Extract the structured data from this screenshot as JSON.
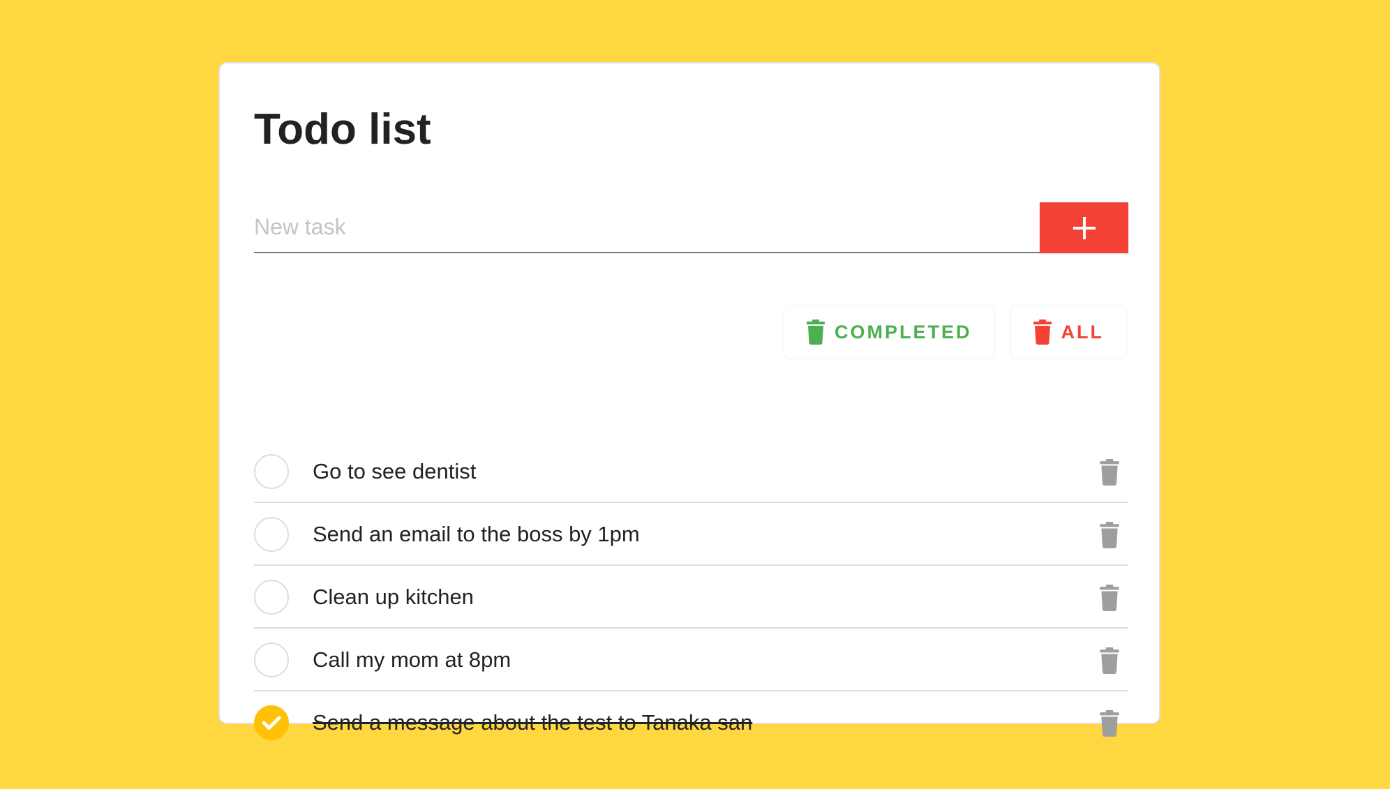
{
  "title": "Todo list",
  "new_task": {
    "placeholder": "New task",
    "value": "",
    "add_icon": "plus-icon"
  },
  "actions": {
    "delete_completed_label": "COMPLETED",
    "delete_all_label": "ALL",
    "icon": "trash-icon"
  },
  "tasks": [
    {
      "text": "Go to see dentist",
      "completed": false
    },
    {
      "text": "Send an email to the boss by 1pm",
      "completed": false
    },
    {
      "text": "Clean up kitchen",
      "completed": false
    },
    {
      "text": "Call my mom at 8pm",
      "completed": false
    },
    {
      "text": "Send a message about the test to Tanaka san",
      "completed": true
    }
  ],
  "colors": {
    "background": "#FFD740",
    "accent_red": "#F44336",
    "accent_green": "#4CAF50",
    "check_yellow": "#FFC107",
    "trash_gray": "#9E9E9E"
  }
}
